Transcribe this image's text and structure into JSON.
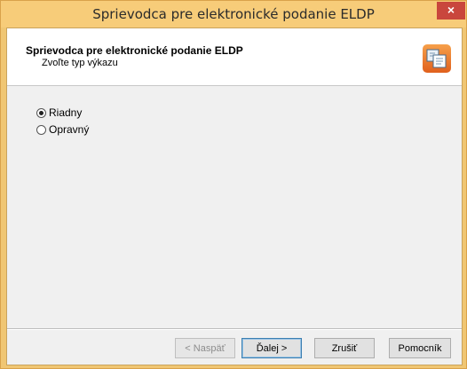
{
  "window": {
    "title": "Sprievodca pre elektronické podanie ELDP",
    "close_glyph": "×"
  },
  "header": {
    "title": "Sprievodca pre elektronické podanie ELDP",
    "subtitle": "Zvoľte typ výkazu",
    "logo_icon": "eldp-wizard-logo-icon"
  },
  "options": {
    "radio1": {
      "label": "Riadny",
      "checked": true
    },
    "radio2": {
      "label": "Opravný",
      "checked": false
    }
  },
  "buttons": {
    "back": "< Naspäť",
    "next": "Ďalej >",
    "cancel": "Zrušiť",
    "help": "Pomocník"
  },
  "colors": {
    "titlebar": "#f7cc79",
    "close": "#c9463d",
    "client_bg": "#f0f0f0",
    "default_button_border": "#3c7fb1"
  }
}
